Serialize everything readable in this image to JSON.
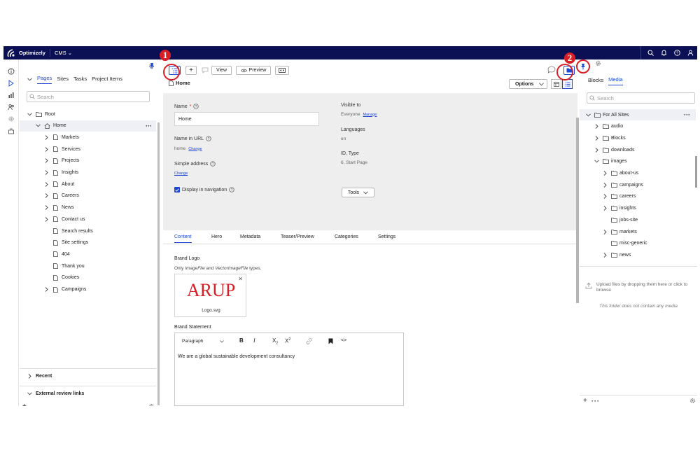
{
  "topbar": {
    "brand": "Optimizely",
    "product": "CMS"
  },
  "left_panel": {
    "tabs": [
      {
        "label": "Pages",
        "active": true
      },
      {
        "label": "Sites",
        "active": false
      },
      {
        "label": "Tasks",
        "active": false
      },
      {
        "label": "Project Items",
        "active": false
      }
    ],
    "search_placeholder": "Search",
    "tree": [
      {
        "label": "Root",
        "level": 0,
        "expanded": true,
        "type": "folder"
      },
      {
        "label": "Home",
        "level": 1,
        "expanded": true,
        "type": "home",
        "selected": true
      },
      {
        "label": "Markets",
        "level": 2,
        "expandable": true,
        "type": "page"
      },
      {
        "label": "Services",
        "level": 2,
        "expandable": true,
        "type": "page"
      },
      {
        "label": "Projects",
        "level": 2,
        "expandable": true,
        "type": "page"
      },
      {
        "label": "Insights",
        "level": 2,
        "expandable": true,
        "type": "page"
      },
      {
        "label": "About",
        "level": 2,
        "expandable": true,
        "type": "page"
      },
      {
        "label": "Careers",
        "level": 2,
        "expandable": true,
        "type": "page"
      },
      {
        "label": "News",
        "level": 2,
        "expandable": true,
        "type": "page"
      },
      {
        "label": "Contact us",
        "level": 2,
        "expandable": true,
        "type": "page"
      },
      {
        "label": "Search results",
        "level": 2,
        "expandable": false,
        "type": "page"
      },
      {
        "label": "Site settings",
        "level": 2,
        "expandable": false,
        "type": "page"
      },
      {
        "label": "404",
        "level": 2,
        "expandable": false,
        "type": "page"
      },
      {
        "label": "Thank you",
        "level": 2,
        "expandable": false,
        "type": "page"
      },
      {
        "label": "Cookies",
        "level": 2,
        "expandable": false,
        "type": "page"
      },
      {
        "label": "Campaigns",
        "level": 2,
        "expandable": true,
        "type": "page"
      }
    ],
    "footer_sections": [
      "Recent",
      "External review links"
    ]
  },
  "toolbar": {
    "view_label": "View",
    "preview_label": "Preview"
  },
  "page": {
    "title": "Home",
    "options_label": "Options"
  },
  "properties": {
    "name_label": "Name",
    "name_required": "*",
    "name_value": "Home",
    "name_in_url_label": "Name in URL",
    "name_in_url_value": "home",
    "change_link": "Change",
    "simple_address_label": "Simple address",
    "display_in_nav_label": "Display in navigation",
    "visible_to_label": "Visible to",
    "visible_to_value": "Everyone",
    "manage_link": "Manage",
    "languages_label": "Languages",
    "languages_value": "en",
    "id_type_label": "ID, Type",
    "id_type_value": "6, Start Page",
    "tools_label": "Tools"
  },
  "content_tabs": [
    "Content",
    "Hero",
    "Metadata",
    "Teaser/Preview",
    "Categories",
    "Settings"
  ],
  "content": {
    "brand_logo_label": "Brand Logo",
    "brand_logo_help_prefix": "Only",
    "brand_logo_help_type1": "ImageFile",
    "brand_logo_help_and": "and",
    "brand_logo_help_type2": "VectorImageFile",
    "brand_logo_help_suffix": "types.",
    "logo_text": "ARUP",
    "logo_filename": "Logo.svg",
    "brand_statement_label": "Brand Statement",
    "editor_format": "Paragraph",
    "editor_bold": "B",
    "editor_italic": "I",
    "editor_text": "We are a global sustainable development consultancy"
  },
  "right_panel": {
    "tabs": [
      {
        "label": "Blocks",
        "active": false
      },
      {
        "label": "Media",
        "active": true
      }
    ],
    "search_placeholder": "Search",
    "tree": [
      {
        "label": "For All Sites",
        "level": 0,
        "expanded": true
      },
      {
        "label": "audio",
        "level": 1,
        "expandable": true
      },
      {
        "label": "Blocks",
        "level": 1,
        "expandable": true
      },
      {
        "label": "downloads",
        "level": 1,
        "expandable": true
      },
      {
        "label": "images",
        "level": 1,
        "expanded": true
      },
      {
        "label": "about-us",
        "level": 2,
        "expandable": true
      },
      {
        "label": "campaigns",
        "level": 2,
        "expandable": true
      },
      {
        "label": "careers",
        "level": 2,
        "expandable": true
      },
      {
        "label": "insights",
        "level": 2,
        "expandable": true
      },
      {
        "label": "jobs-site",
        "level": 2,
        "expandable": false
      },
      {
        "label": "markets",
        "level": 2,
        "expandable": true
      },
      {
        "label": "misc-generic",
        "level": 2,
        "expandable": false
      },
      {
        "label": "news",
        "level": 2,
        "expandable": true
      }
    ],
    "upload_text": "Upload files by dropping them here or click to browse",
    "empty_note": "This folder does not contain any media"
  },
  "callouts": [
    "1",
    "2"
  ],
  "colors": {
    "topbar": "#0b1054",
    "accent": "#1b47d4",
    "callout": "#d81f26",
    "props_bg": "#eeeeee",
    "logo_red": "#d81f26"
  }
}
